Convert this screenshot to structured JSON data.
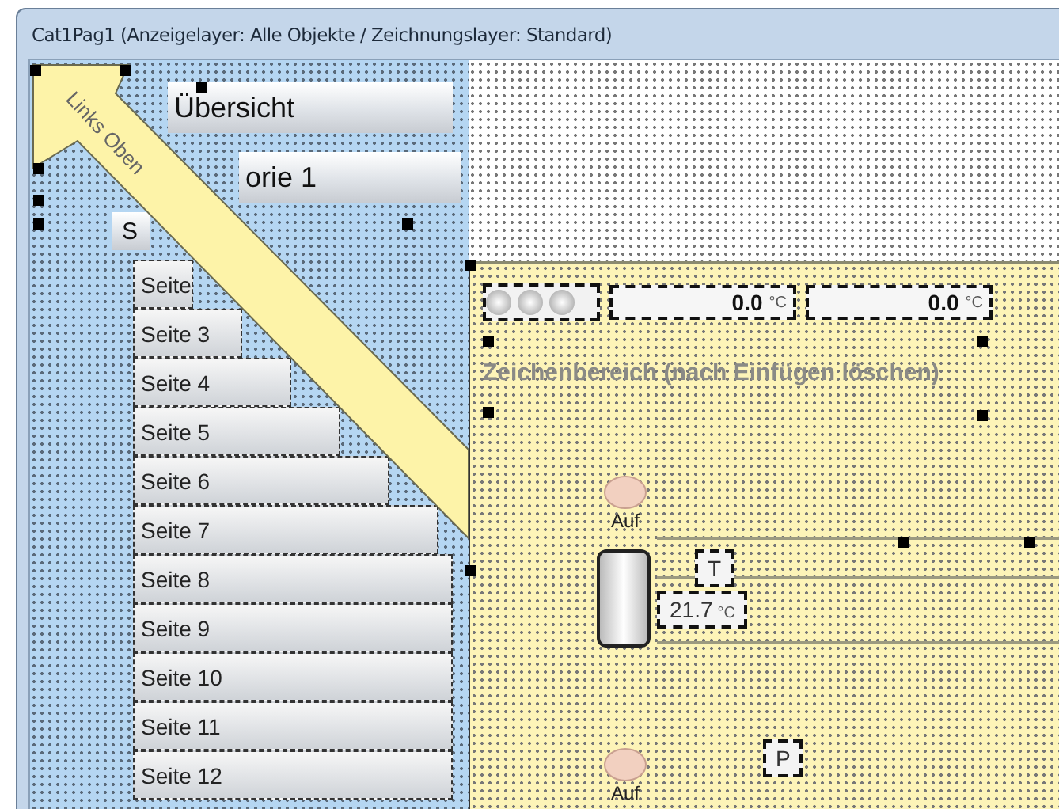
{
  "window": {
    "title": "Cat1Pag1  (Anzeigelayer: Alle Objekte / Zeichnungslayer: Standard)"
  },
  "navigation": {
    "buttons": [
      {
        "label": "Übersicht",
        "kind": "main"
      },
      {
        "label": "orie 1",
        "kind": "category"
      },
      {
        "label": "S",
        "kind": "sub"
      }
    ],
    "pages": [
      "Seite",
      "Seite 3",
      "Seite 4",
      "Seite 5",
      "Seite 6",
      "Seite 7",
      "Seite 8",
      "Seite 9",
      "Seite 10",
      "Seite 11",
      "Seite 12"
    ]
  },
  "banner": {
    "label": "Links Oben"
  },
  "canvas": {
    "readouts": [
      {
        "value": "0.0",
        "unit": "°C"
      },
      {
        "value": "0.0",
        "unit": "°C"
      }
    ],
    "caption": "Zeichenbereich (nach Einfügen löschen)",
    "valves": [
      {
        "label": "Auf"
      },
      {
        "label": "Auf"
      }
    ],
    "sensor": {
      "label": "T"
    },
    "temperature": {
      "value": "21.7",
      "unit": "°C"
    },
    "pump": {
      "label": "P"
    }
  }
}
